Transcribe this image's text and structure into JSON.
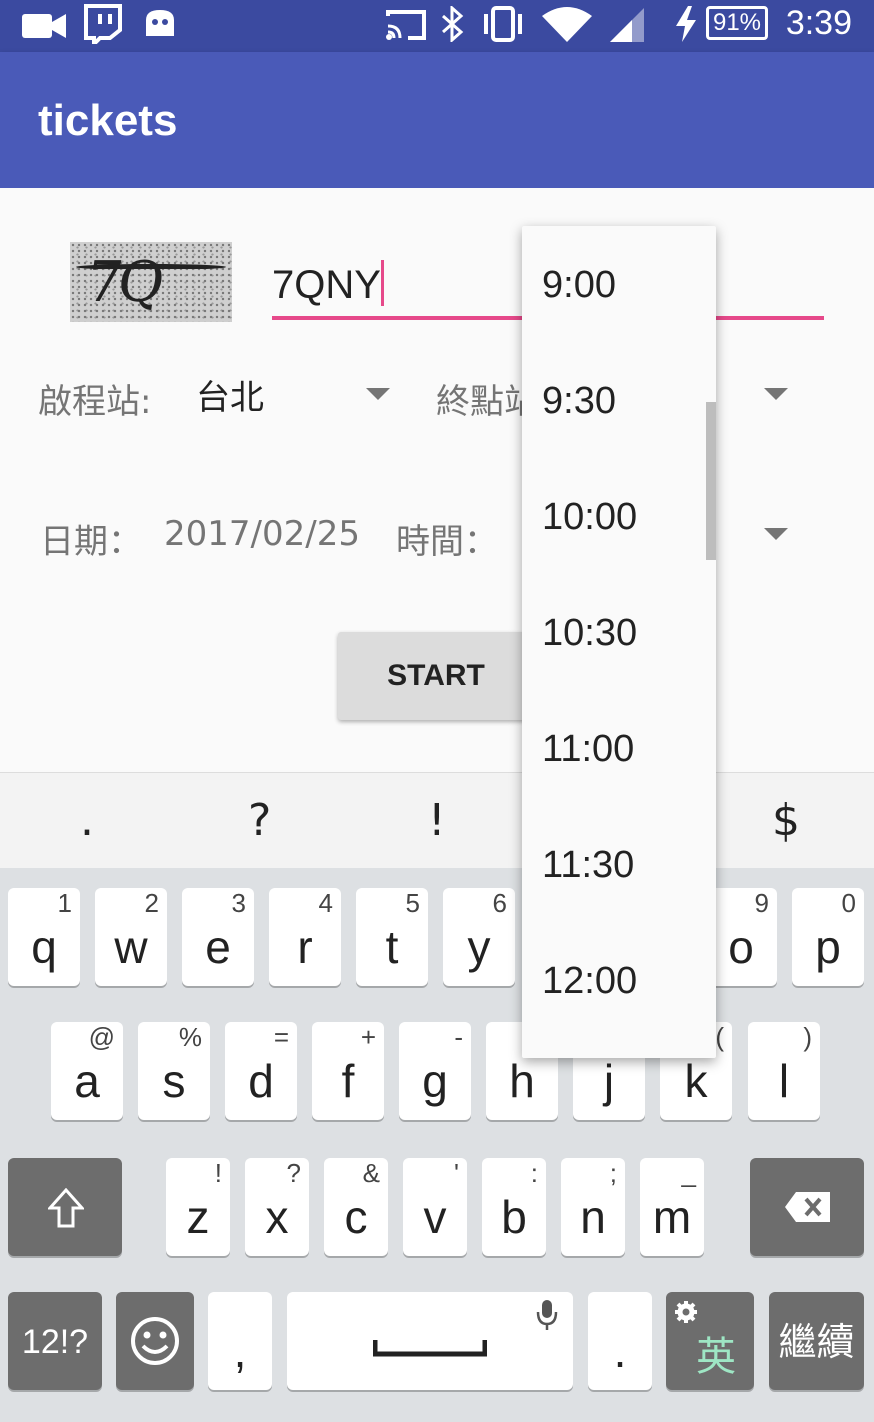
{
  "status_bar": {
    "time": "3:39",
    "battery_percent": "91%",
    "icons": [
      "video-icon",
      "twitch-icon",
      "android-icon",
      "cast-icon",
      "bluetooth-icon",
      "vibrate-icon",
      "wifi-icon",
      "signal-icon",
      "charging-icon",
      "battery-icon"
    ]
  },
  "app_bar": {
    "title": "tickets"
  },
  "form": {
    "captcha_text": "7Q NY",
    "code_value": "7QNY",
    "origin_label": "啟程站:",
    "origin_value": "台北",
    "destination_label": "終點站",
    "date_label": "日期：",
    "date_value": "2017/02/25",
    "time_label": "時間：",
    "start_label": "START"
  },
  "time_dropdown": {
    "options": [
      "9:00",
      "9:30",
      "10:00",
      "10:30",
      "11:00",
      "11:30",
      "12:00"
    ]
  },
  "keyboard": {
    "suggestions": [
      ".",
      "?",
      "!",
      "$"
    ],
    "row1": [
      {
        "key": "q",
        "hint": "1"
      },
      {
        "key": "w",
        "hint": "2"
      },
      {
        "key": "e",
        "hint": "3"
      },
      {
        "key": "r",
        "hint": "4"
      },
      {
        "key": "t",
        "hint": "5"
      },
      {
        "key": "y",
        "hint": "6"
      },
      {
        "key": "o",
        "hint": "9"
      },
      {
        "key": "p",
        "hint": "0"
      }
    ],
    "row2": [
      {
        "key": "a",
        "hint": "@"
      },
      {
        "key": "s",
        "hint": "%"
      },
      {
        "key": "d",
        "hint": "="
      },
      {
        "key": "f",
        "hint": "+"
      },
      {
        "key": "g",
        "hint": "-"
      },
      {
        "key": "h",
        "hint": ""
      },
      {
        "key": "j",
        "hint": ""
      },
      {
        "key": "k",
        "hint": "("
      },
      {
        "key": "l",
        "hint": ")"
      }
    ],
    "row3": [
      {
        "key": "z",
        "hint": "!"
      },
      {
        "key": "x",
        "hint": "?"
      },
      {
        "key": "c",
        "hint": "&"
      },
      {
        "key": "v",
        "hint": "'"
      },
      {
        "key": "b",
        "hint": ":"
      },
      {
        "key": "n",
        "hint": ";"
      },
      {
        "key": "m",
        "hint": "_"
      }
    ],
    "symbols_key": "12!?",
    "comma_key": ",",
    "period_key": ".",
    "language_key": "英",
    "action_key": "繼續"
  }
}
